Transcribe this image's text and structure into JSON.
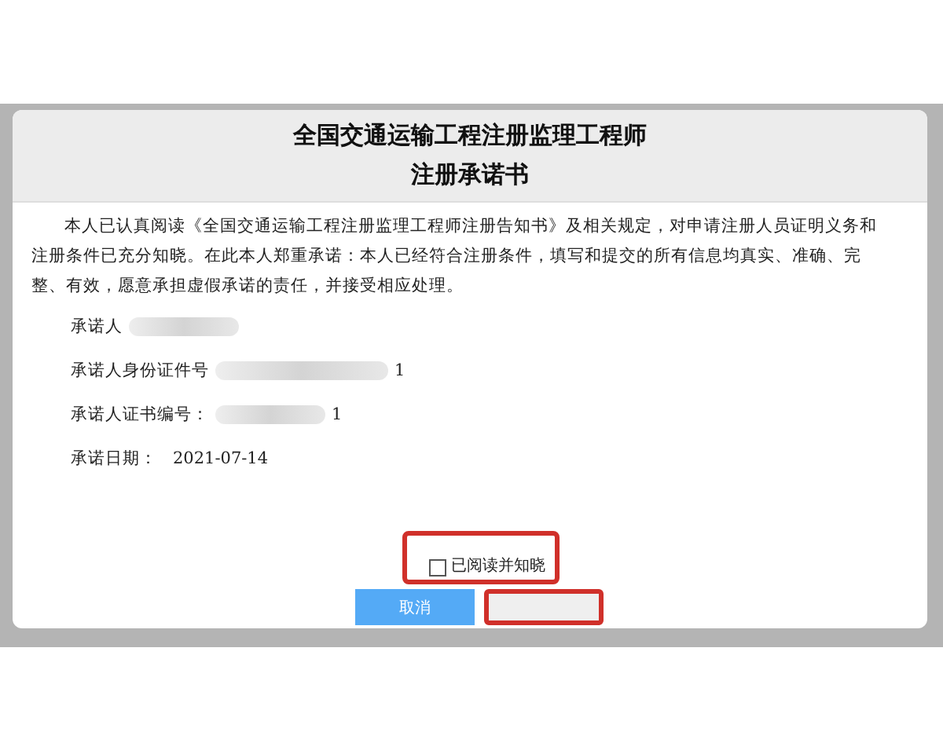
{
  "dialog": {
    "title_lines": [
      "全国交通运输工程注册监理工程师",
      "注册承诺书"
    ],
    "statement": "本人已认真阅读《全国交通运输工程注册监理工程师注册告知书》及相关规定，对申请注册人员证明义务和注册条件已充分知晓。在此本人郑重承诺：本人已经符合注册条件，填写和提交的所有信息均真实、准确、完整、有效，愿意承担虚假承诺的责任，并接受相应处理。",
    "fields": [
      {
        "label": "承诺人",
        "redacted": true
      },
      {
        "label": "承诺人身份证件号",
        "redacted": true,
        "value": "1"
      },
      {
        "label": "承诺人证书编号：",
        "redacted": true,
        "value": "1"
      },
      {
        "label": "承诺日期：",
        "redacted": false,
        "value": "2021-07-14"
      }
    ],
    "agreement": {
      "label": "已阅读并知晓",
      "checked": false,
      "highlighted": true
    },
    "buttons": [
      {
        "label": "取消",
        "kind": "cancel",
        "disabled": false,
        "highlighted": false
      },
      {
        "kind": "confirm",
        "disabled": true,
        "highlighted": true
      }
    ]
  }
}
